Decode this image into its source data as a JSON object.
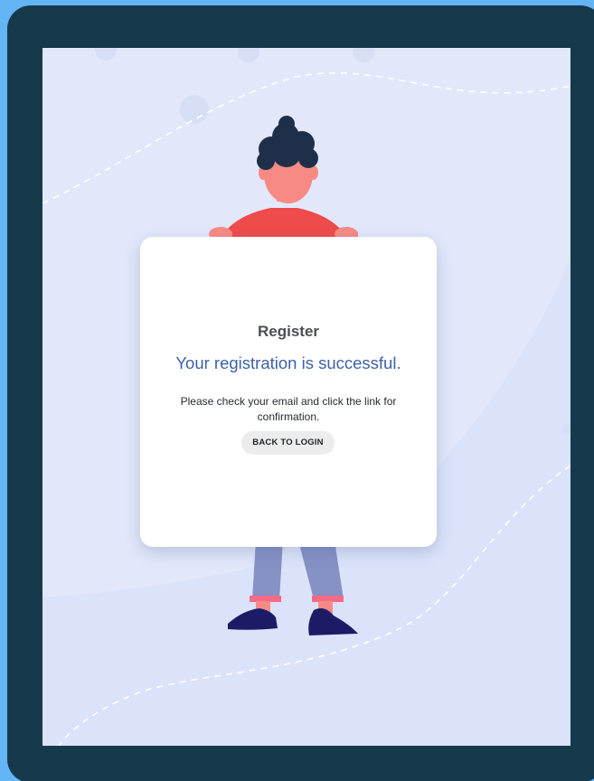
{
  "colors": {
    "page_background": "#64b5f6",
    "device_frame": "#163a4b",
    "screen_background": "#e2e8fa",
    "success_text": "#3d62a6",
    "shirt": "#ee4b4b",
    "skin": "#f88a85",
    "hair": "#1f2f49",
    "pants": "#8691c4",
    "shoes": "#1c1b66"
  },
  "illustration": {
    "subject": "person holding a sign"
  },
  "card": {
    "title": "Register",
    "success_message": "Your registration is successful.",
    "instruction": "Please check your email and click the link for confirmation.",
    "back_button_label": "BACK TO LOGIN"
  }
}
